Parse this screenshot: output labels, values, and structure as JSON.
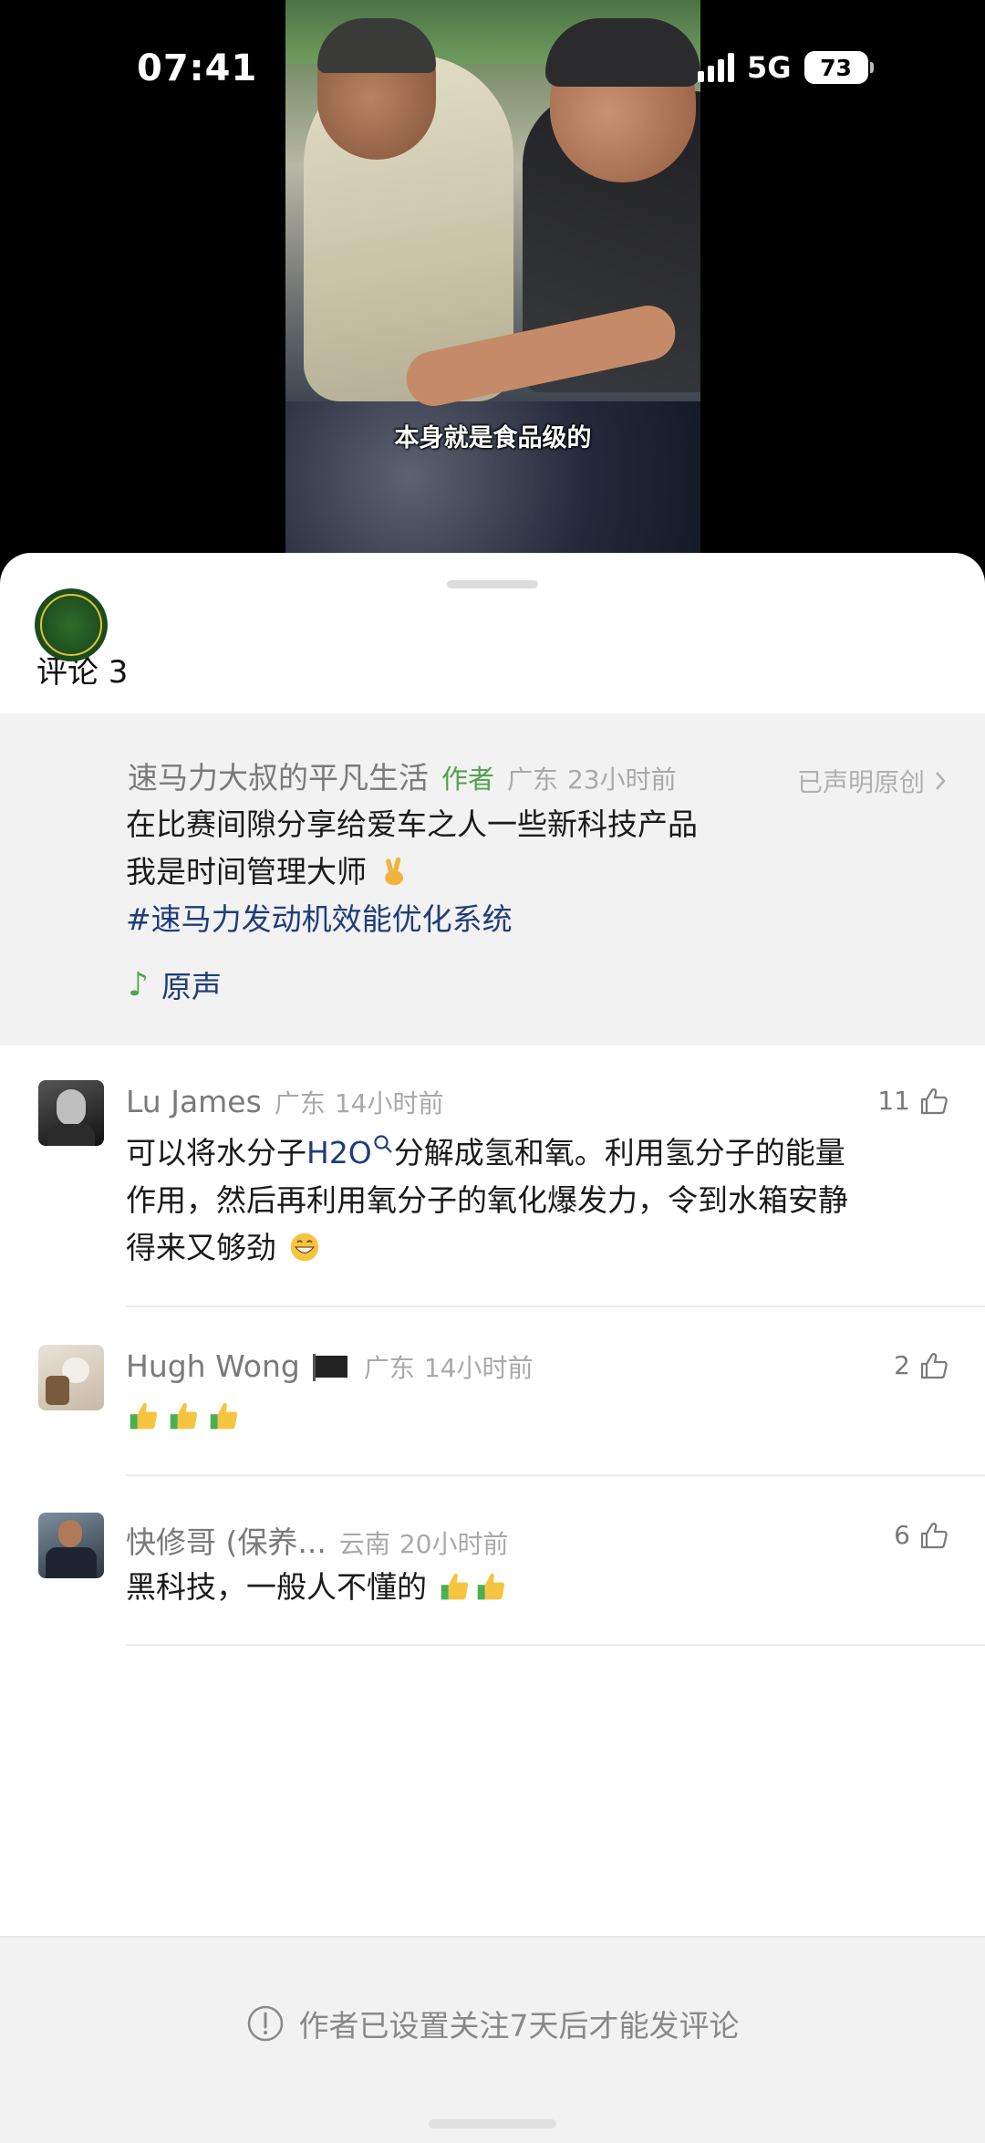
{
  "status_bar": {
    "time": "07:41",
    "network": "5G",
    "battery": "73"
  },
  "video": {
    "subtitle": "本身就是食品级的"
  },
  "comments_header": {
    "title": "评论 3"
  },
  "post": {
    "author_name": "速马力大叔的平凡生活",
    "author_tag": "作者",
    "location": "广东",
    "time": "23小时前",
    "original_label": "已声明原创",
    "line1": "在比赛间隙分享给爱车之人一些新科技产品",
    "line2": "我是时间管理大师",
    "hashtag": "#速马力发动机效能优化系统",
    "music_label": "原声"
  },
  "comments": [
    {
      "name": "Lu James",
      "location": "广东",
      "time": "14小时前",
      "likes": "11",
      "text_pre": "可以将水分子",
      "link": "H2O",
      "text_post": "分解成氢和氧。利用氢分子的能量",
      "text_line2": "作用，然后再利用氧分子的氧化爆发力，令到水箱安静",
      "text_line3": "得来又够劲"
    },
    {
      "name": "Hugh Wong",
      "location": "广东",
      "time": "14小时前",
      "likes": "2"
    },
    {
      "name": "快修哥 (保养...",
      "location": "云南",
      "time": "20小时前",
      "likes": "6",
      "text": "黑科技，一般人不懂的"
    }
  ],
  "footer": {
    "notice": "作者已设置关注7天后才能发评论"
  },
  "icons": {
    "like": "thumb-up-icon",
    "chevron": "chevron-right-icon",
    "search": "search-icon",
    "info": "info-circle-icon",
    "music": "music-note-icon"
  }
}
